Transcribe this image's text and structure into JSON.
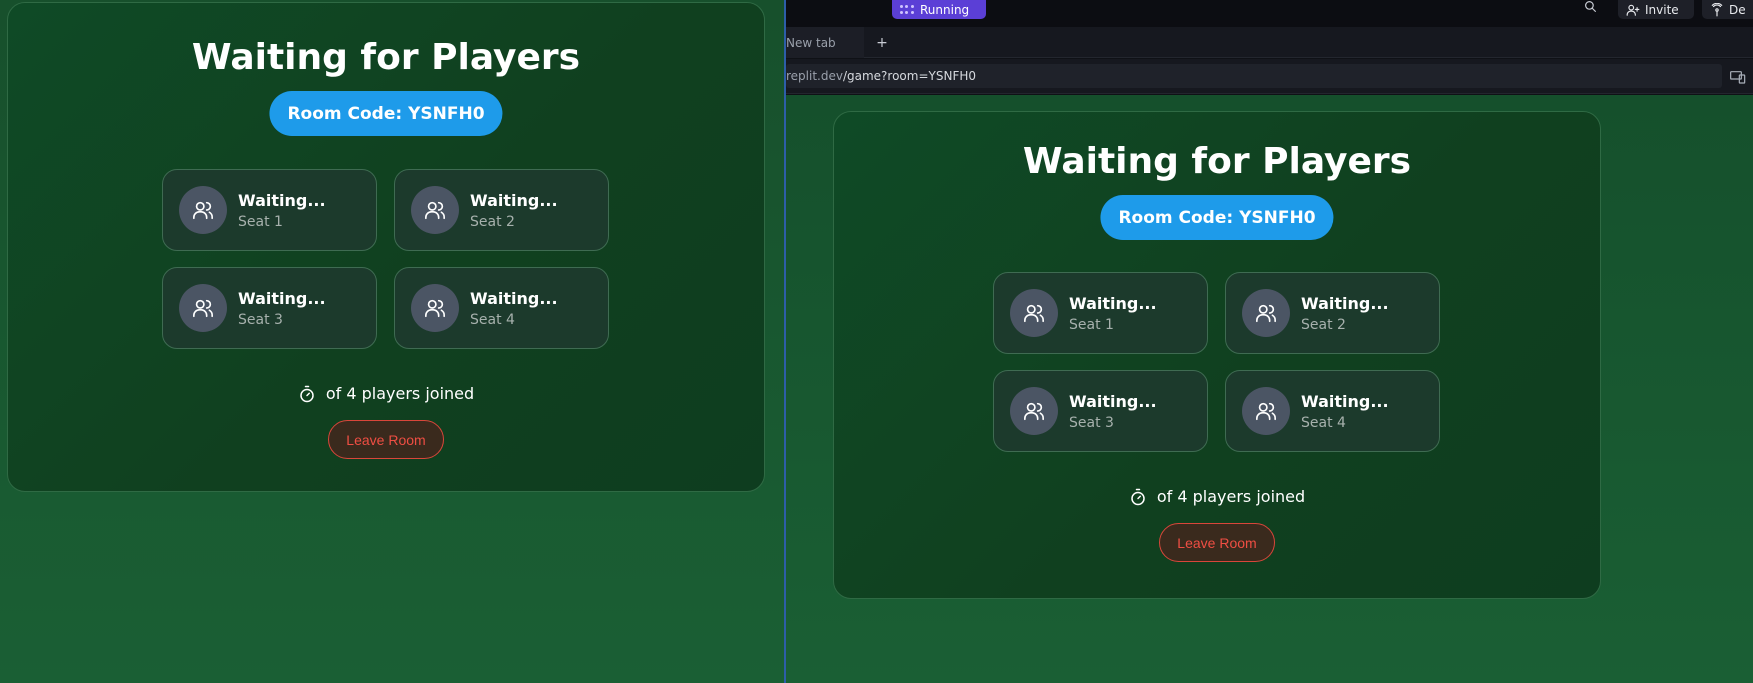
{
  "ide": {
    "run_label": "Running",
    "invite_label": "Invite",
    "deploy_label": "De",
    "tab_label": "New tab",
    "tab_add": "+",
    "url_host": "replit.dev",
    "url_path": "/game?room=YSNFH0"
  },
  "game": {
    "title": "Waiting for Players",
    "room_code": "Room Code: YSNFH0",
    "seats": [
      {
        "status": "Waiting...",
        "label": "Seat 1"
      },
      {
        "status": "Waiting...",
        "label": "Seat 2"
      },
      {
        "status": "Waiting...",
        "label": "Seat 3"
      },
      {
        "status": "Waiting...",
        "label": "Seat 4"
      }
    ],
    "joined_text": "of 4 players joined",
    "leave_label": "Leave Room"
  },
  "colors": {
    "room_code_bg": "#1e9bea",
    "leave_red": "#ef4e43",
    "run_purple": "#5b3fd6"
  },
  "icons": {
    "seat": "users-icon",
    "timer": "stopwatch-icon",
    "search": "search-icon",
    "invite": "user-plus-icon",
    "deploy": "deploy-icon",
    "devices": "devices-icon"
  }
}
